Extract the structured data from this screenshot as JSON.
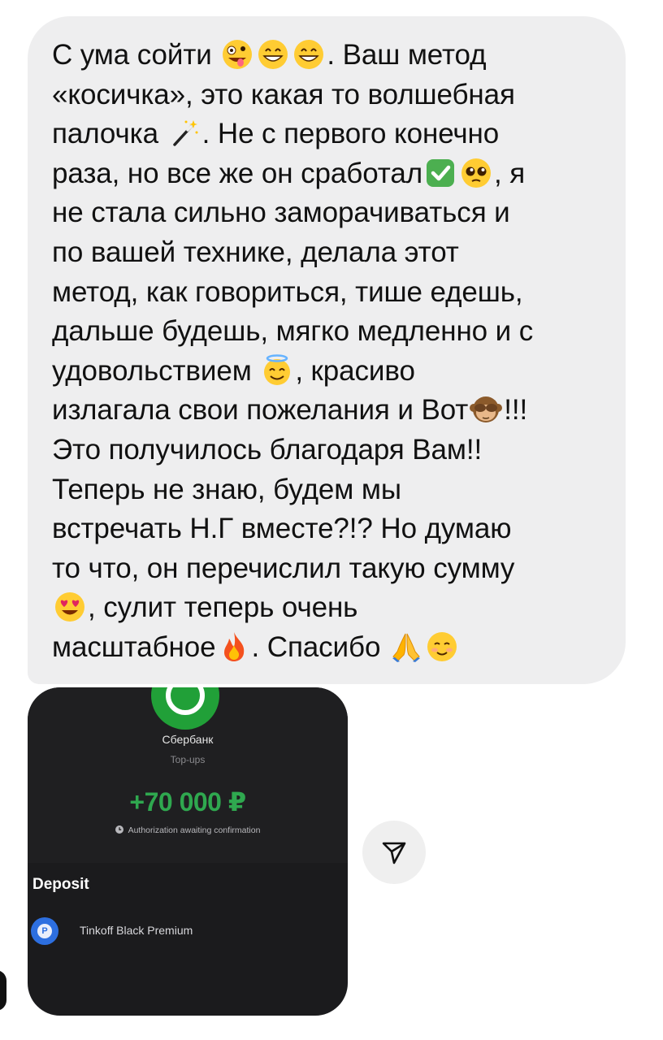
{
  "message": {
    "lines": [
      [
        "С ума сойти ",
        "e:zany",
        "e:grin",
        "e:grin",
        ". Ваш метод"
      ],
      [
        "«косичка», это какая то волшебная"
      ],
      [
        "палочка ",
        "e:wand",
        ". Не с первого конечно"
      ],
      [
        "раза, но все же он сработал",
        "e:check",
        "e:pleading",
        ", я"
      ],
      [
        "не стала сильно заморачиваться и"
      ],
      [
        "по вашей технике, делала этот"
      ],
      [
        "метод, как говориться, тише едешь,"
      ],
      [
        "дальше будешь, мягко медленно и с"
      ],
      [
        "удовольствием ",
        "e:halo",
        ", красиво"
      ],
      [
        "излагала свои пожелания и Вот",
        "e:monkey",
        "!!!"
      ],
      [
        "Это получилось благодаря Вам!!"
      ],
      [
        "Теперь не знаю, будем мы"
      ],
      [
        "встречать Н.Г вместе?!? Но думаю"
      ],
      [
        "то что, он перечислил такую сумму"
      ],
      [
        "e:hearteyes",
        ", сулит теперь очень"
      ],
      [
        "масштабное",
        "e:fire",
        ". Спасибо ",
        "e:pray",
        "e:smiling"
      ]
    ],
    "emoji_names": {
      "zany": "zany-face-emoji",
      "grin": "grinning-face-emoji",
      "wand": "magic-wand-emoji",
      "check": "check-mark-button-emoji",
      "pleading": "pleading-face-emoji",
      "halo": "smiling-face-with-halo-emoji",
      "monkey": "see-no-evil-monkey-emoji",
      "hearteyes": "heart-eyes-emoji",
      "fire": "fire-emoji",
      "pray": "folded-hands-emoji",
      "smiling": "smiling-face-emoji"
    }
  },
  "attachment": {
    "bank_name": "Сбербанк",
    "category": "Top-ups",
    "amount": "+70 000 ₽",
    "status": "Authorization awaiting confirmation",
    "deposit_title": "Deposit",
    "card_name": "Tinkoff Black Premium",
    "card_letter": "P"
  },
  "colors": {
    "bubble_bg": "#eeeeef",
    "text": "#111111",
    "amount_green": "#2fa84f",
    "sber_green": "#21a038",
    "card_blue": "#2d6fe0",
    "dark_bg": "#1b1b1d"
  },
  "icons": {
    "share": "paper-plane-icon",
    "clock": "clock-icon",
    "bank_logo": "sberbank-logo-icon"
  }
}
